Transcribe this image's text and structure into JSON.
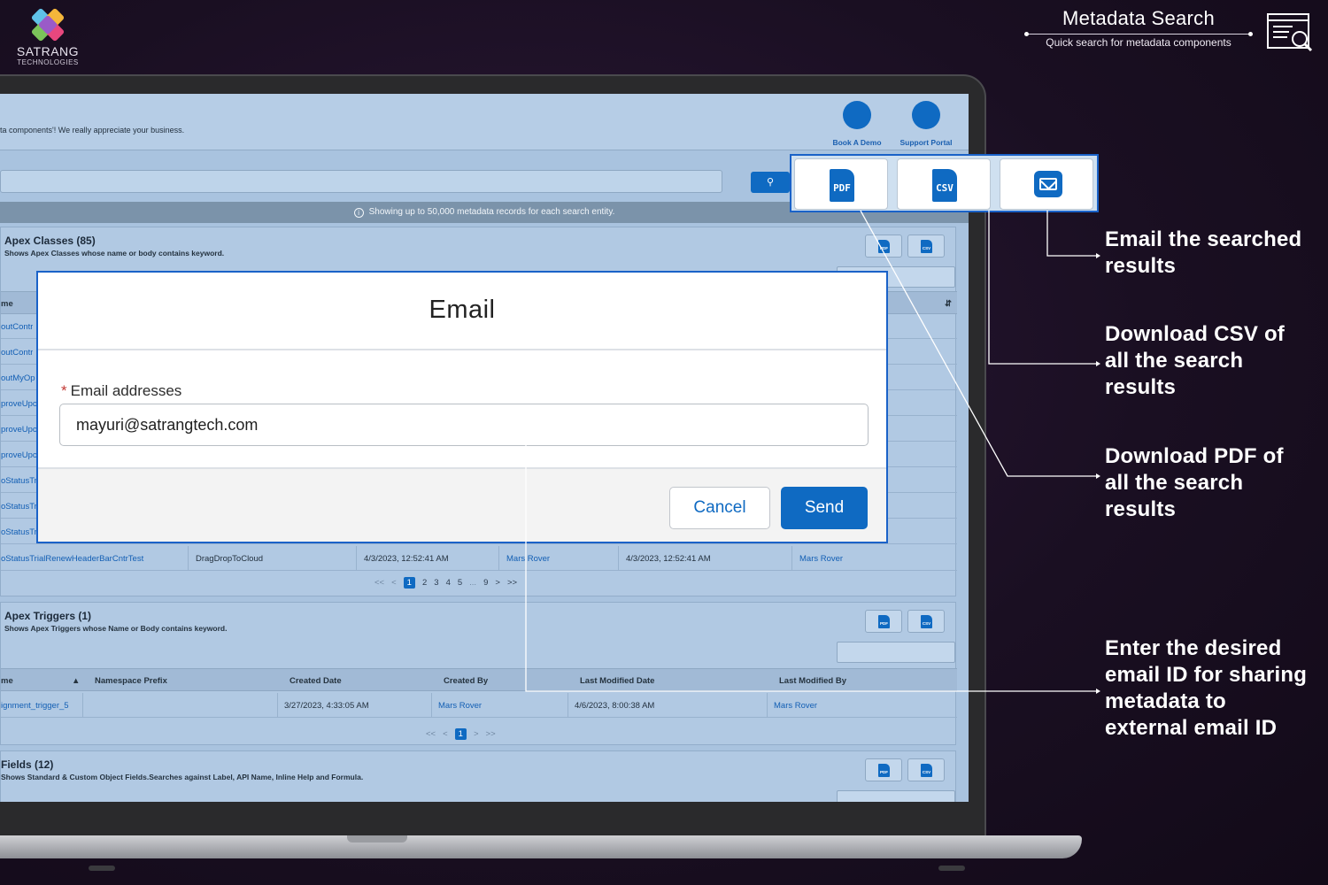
{
  "brand": {
    "name": "SATRANG",
    "tagline": "TECHNOLOGIES"
  },
  "header": {
    "title": "Metadata Search",
    "subtitle": "Quick search for metadata components"
  },
  "app": {
    "thanks_text": "ta components'! We really appreciate your business.",
    "header_buttons": [
      {
        "label": "Book A Demo"
      },
      {
        "label": "Support Portal"
      }
    ],
    "info_text": "Showing up to 50,000 metadata records for each search entity.",
    "export_buttons": [
      {
        "label": "PDF"
      },
      {
        "label": "CSV"
      },
      {
        "icon": "email-icon"
      }
    ],
    "sections": {
      "apex_classes": {
        "title": "Apex Classes (85)",
        "desc": "Shows Apex Classes whose name or body contains keyword.",
        "col_first": "me",
        "row_stubs": [
          "outContr",
          "outContr",
          "outMyOp",
          "proveUpc",
          "proveUpc",
          "proveUpc",
          "oStatusTr",
          "oStatusTr",
          "oStatusTr"
        ],
        "last_row": [
          "oStatusTrialRenewHeaderBarCntrTest",
          "DragDropToCloud",
          "4/3/2023, 12:52:41 AM",
          "Mars Rover",
          "4/3/2023, 12:52:41 AM",
          "Mars Rover"
        ],
        "pager": [
          "<<",
          "<",
          "1",
          "2",
          "3",
          "4",
          "5",
          "...",
          "9",
          ">",
          ">>"
        ]
      },
      "apex_triggers": {
        "title": "Apex Triggers (1)",
        "desc": "Shows Apex Triggers whose Name or Body contains keyword.",
        "columns": [
          "me",
          "Namespace Prefix",
          "Created Date",
          "Created By",
          "Last Modified Date",
          "Last Modified By"
        ],
        "row": [
          "ignment_trigger_5",
          "",
          "3/27/2023, 4:33:05 AM",
          "Mars Rover",
          "4/6/2023, 8:00:38 AM",
          "Mars Rover"
        ],
        "pager": [
          "<<",
          "<",
          "1",
          ">",
          ">>"
        ]
      },
      "fields": {
        "title": "Fields (12)",
        "desc": "Shows Standard & Custom Object Fields.Searches against Label, API Name, Inline Help and Formula."
      }
    }
  },
  "modal": {
    "title": "Email",
    "field_label": "Email addresses",
    "required_mark": "*",
    "email_value": "mayuri@satrangtech.com",
    "cancel_label": "Cancel",
    "send_label": "Send"
  },
  "callouts": [
    {
      "lines": [
        "Email the searched",
        "results"
      ]
    },
    {
      "lines": [
        "Download CSV of",
        "all the search",
        "results"
      ]
    },
    {
      "lines": [
        "Download PDF of",
        "all the search",
        "results"
      ]
    },
    {
      "lines": [
        "Enter the desired",
        "email ID for sharing",
        "metadata to",
        "external email ID"
      ]
    }
  ],
  "colors": {
    "accent": "#0f6ac2",
    "highlight_border": "#1a62c8",
    "background": "#1a0f22",
    "screen": "#a9c3df"
  }
}
